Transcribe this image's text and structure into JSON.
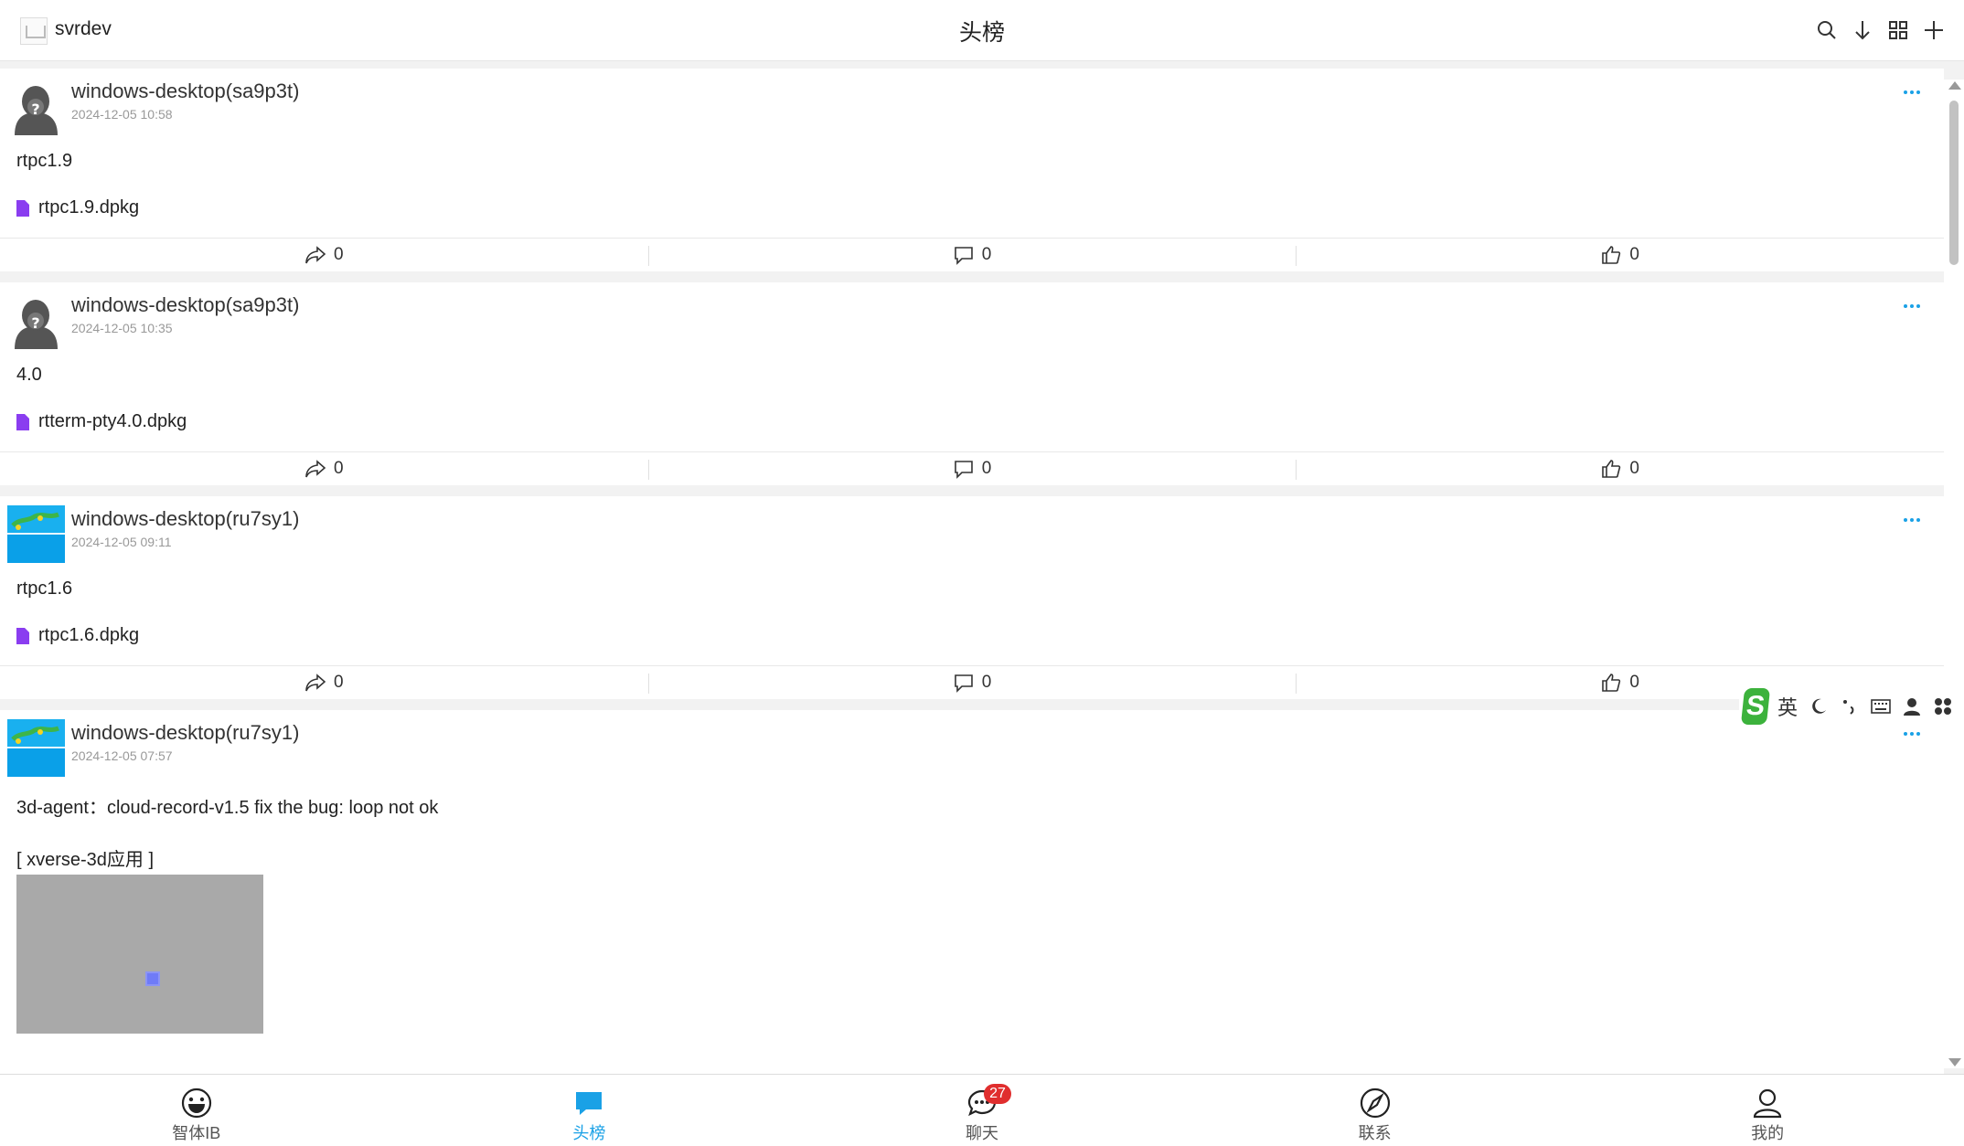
{
  "header": {
    "app_name": "svrdev",
    "title": "头榜",
    "icons": [
      "search-icon",
      "download-icon",
      "grid-icon",
      "plus-icon"
    ]
  },
  "posts": [
    {
      "author": "windows-desktop(sa9p3t)",
      "time": "2024-12-05 10:58",
      "avatar": "hooded-user-avatar",
      "content": "rtpc1.9",
      "attachment": "rtpc1.9.dpkg",
      "shares": "0",
      "comments": "0",
      "likes": "0"
    },
    {
      "author": "windows-desktop(sa9p3t)",
      "time": "2024-12-05 10:35",
      "avatar": "hooded-user-avatar",
      "content": "4.0",
      "attachment": "rtterm-pty4.0.dpkg",
      "shares": "0",
      "comments": "0",
      "likes": "0"
    },
    {
      "author": "windows-desktop(ru7sy1)",
      "time": "2024-12-05 09:11",
      "avatar": "landscape-avatar",
      "content": "rtpc1.6",
      "attachment": "rtpc1.6.dpkg",
      "shares": "0",
      "comments": "0",
      "likes": "0"
    },
    {
      "author": "windows-desktop(ru7sy1)",
      "time": "2024-12-05 07:57",
      "avatar": "landscape-avatar",
      "content": "3d-agent：cloud-record-v1.5 fix the bug: loop not ok",
      "group": "[ xverse-3d应用 ]"
    }
  ],
  "ime": {
    "lang": "英"
  },
  "bottom_nav": [
    {
      "label": "智体IB",
      "icon": "smiley-icon",
      "active": false
    },
    {
      "label": "头榜",
      "icon": "chat-bubble-icon",
      "active": true
    },
    {
      "label": "聊天",
      "icon": "chat-icon",
      "active": false,
      "badge": "27"
    },
    {
      "label": "联系",
      "icon": "compass-icon",
      "active": false
    },
    {
      "label": "我的",
      "icon": "user-icon",
      "active": false
    }
  ],
  "colors": {
    "accent": "#1aa1e6",
    "badge": "#e02e2e",
    "file_icon": "#8a3df0",
    "ime_logo": "#3cb23c"
  }
}
